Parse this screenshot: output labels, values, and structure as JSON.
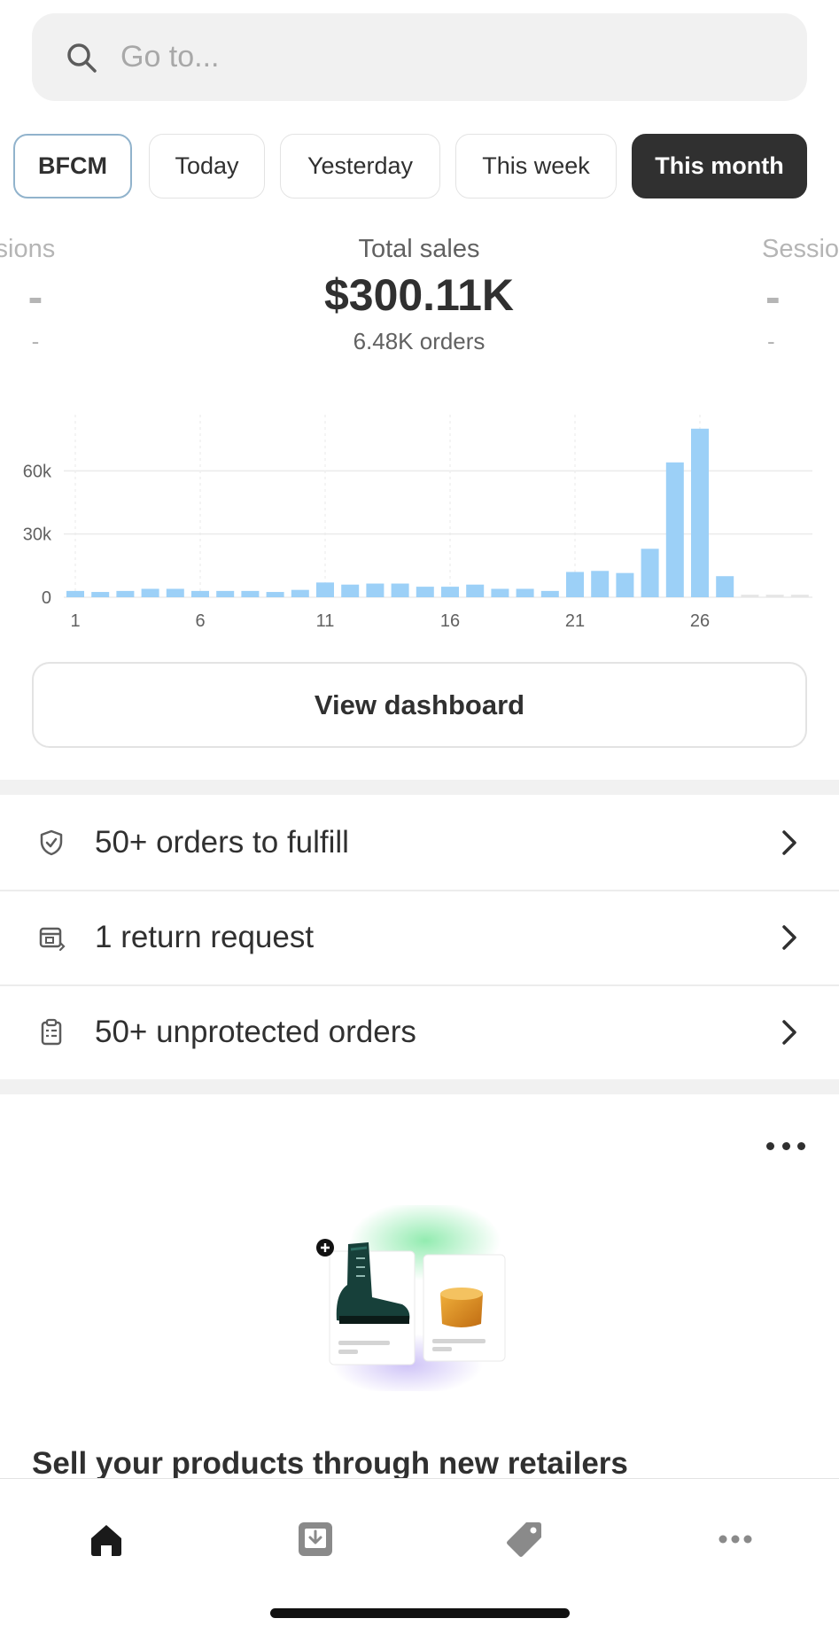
{
  "search": {
    "placeholder": "Go to..."
  },
  "date_filters": [
    {
      "label": "BFCM"
    },
    {
      "label": "Today"
    },
    {
      "label": "Yesterday"
    },
    {
      "label": "This week"
    },
    {
      "label": "This month",
      "selected": true
    }
  ],
  "metrics": {
    "left": {
      "label": "ssions",
      "value": "-",
      "sub": "-"
    },
    "main": {
      "label": "Total sales",
      "value": "$300.11K",
      "sub": "6.48K orders"
    },
    "right": {
      "label": "Sessio",
      "value": "-",
      "sub": "-"
    }
  },
  "chart_data": {
    "type": "bar",
    "x": [
      1,
      2,
      3,
      4,
      5,
      6,
      7,
      8,
      9,
      10,
      11,
      12,
      13,
      14,
      15,
      16,
      17,
      18,
      19,
      20,
      21,
      22,
      23,
      24,
      25,
      26,
      27,
      28,
      29,
      30
    ],
    "values": [
      3000,
      2500,
      3000,
      4000,
      4000,
      3000,
      3000,
      3000,
      2500,
      3500,
      7000,
      6000,
      6500,
      6500,
      5000,
      5000,
      6000,
      4000,
      4000,
      3000,
      12000,
      12500,
      11500,
      23000,
      64000,
      80000,
      10000,
      1200,
      1200,
      1200
    ],
    "x_ticks": [
      "1",
      "6",
      "11",
      "16",
      "21",
      "26"
    ],
    "y_ticks": [
      "0",
      "30k",
      "60k"
    ],
    "ylim": [
      0,
      90000
    ],
    "grid": true,
    "bar_color": "#9cd0f7",
    "future_bar_color": "#e6e6e6"
  },
  "view_dashboard_label": "View dashboard",
  "tasks": [
    {
      "label": "50+ orders to fulfill",
      "icon": "shield-check-icon"
    },
    {
      "label": "1 return request",
      "icon": "return-icon"
    },
    {
      "label": "50+ unprotected orders",
      "icon": "clipboard-icon"
    }
  ],
  "promo": {
    "title": "Sell your products through new retailers"
  },
  "nav": [
    {
      "icon": "home-icon",
      "selected": true
    },
    {
      "icon": "orders-icon"
    },
    {
      "icon": "products-tag-icon"
    },
    {
      "icon": "more-icon"
    }
  ]
}
